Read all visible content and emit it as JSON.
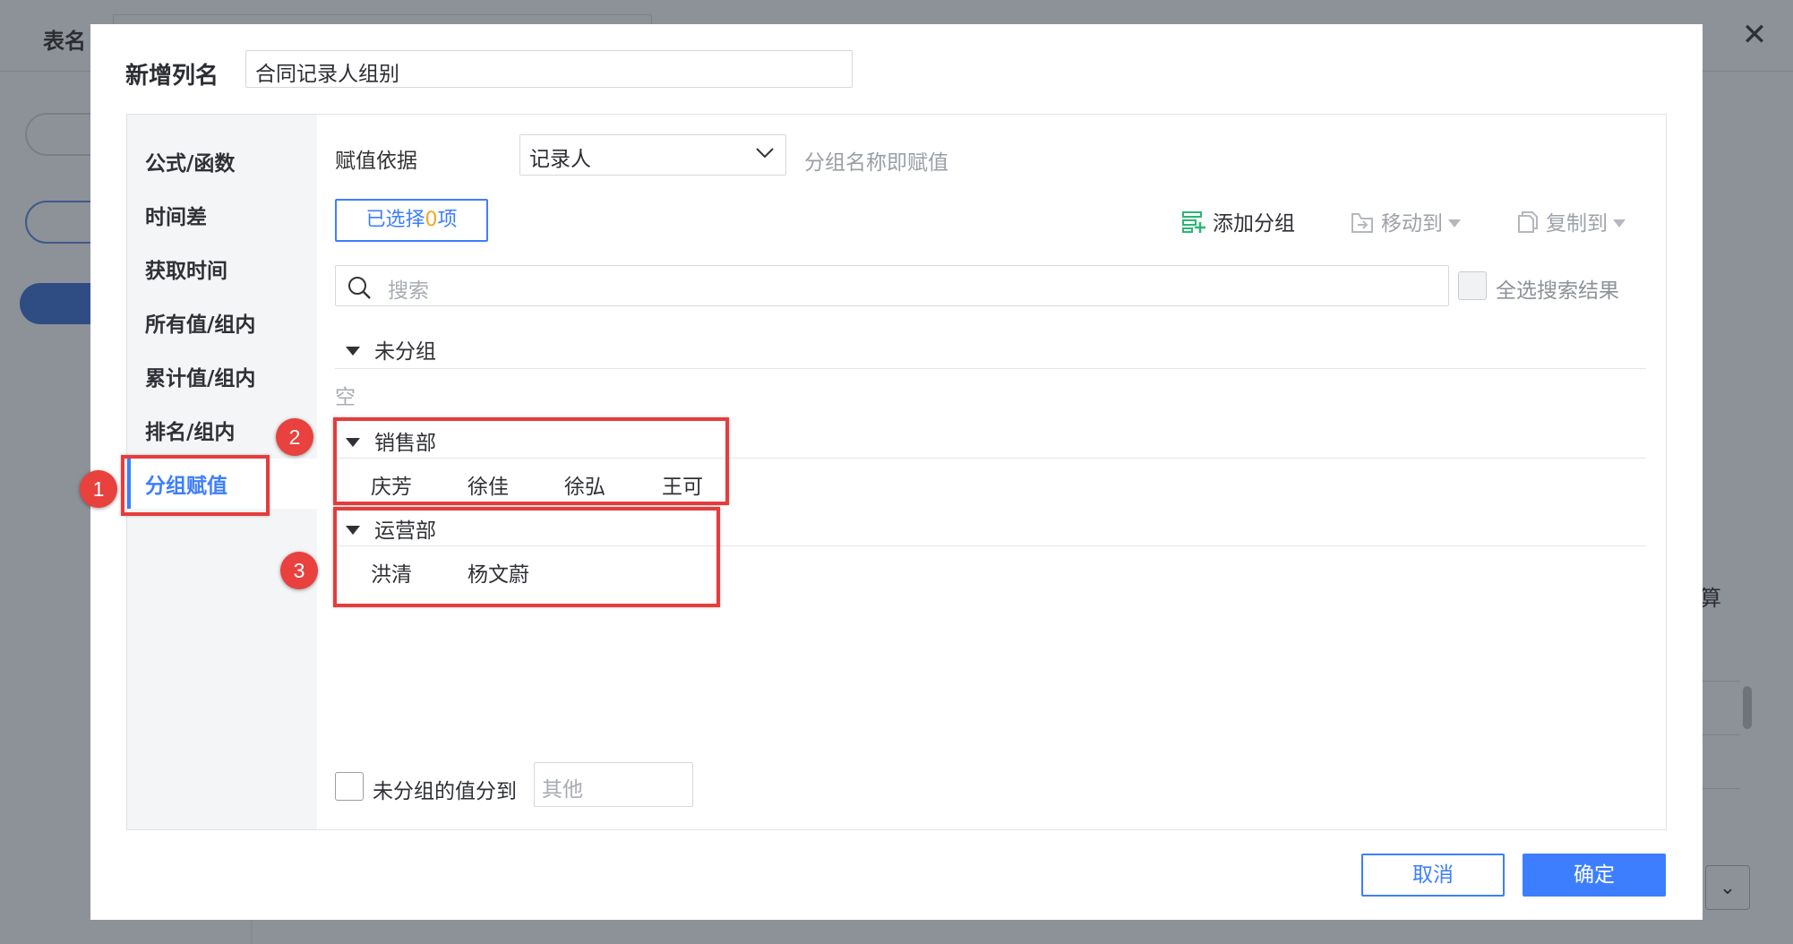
{
  "background": {
    "title": "表名",
    "calc_label": "算"
  },
  "dialog": {
    "name_label": "新增列名",
    "name_value": "合同记录人组别",
    "nav": [
      {
        "label": "公式/函数",
        "active": false
      },
      {
        "label": "时间差",
        "active": false
      },
      {
        "label": "获取时间",
        "active": false
      },
      {
        "label": "所有值/组内",
        "active": false
      },
      {
        "label": "累计值/组内",
        "active": false
      },
      {
        "label": "排名/组内",
        "active": false
      },
      {
        "label": "分组赋值",
        "active": true
      }
    ],
    "assign_basis_label": "赋值依据",
    "assign_basis_value": "记录人",
    "assign_hint": "分组名称即赋值",
    "selected_prefix": "已选择",
    "selected_count": "0",
    "selected_suffix": "项",
    "toolbar": {
      "add_group": "添加分组",
      "move_to": "移动到",
      "copy_to": "复制到"
    },
    "search_placeholder": "搜索",
    "select_all_results": "全选搜索结果",
    "groups": [
      {
        "name": "未分组",
        "members": [],
        "empty_text": "空"
      },
      {
        "name": "销售部",
        "members": [
          "庆芳",
          "徐佳",
          "徐弘",
          "王可"
        ]
      },
      {
        "name": "运营部",
        "members": [
          "洪清",
          "杨文蔚"
        ]
      }
    ],
    "ungrouped_to_label": "未分组的值分到",
    "ungrouped_to_placeholder": "其他",
    "cancel": "取消",
    "ok": "确定"
  },
  "annotations": [
    "1",
    "2",
    "3"
  ],
  "colors": {
    "accent": "#3d7eff",
    "annotation_red": "#e63c3c",
    "count_orange": "#f5a623",
    "add_icon_green": "#2bb673"
  }
}
